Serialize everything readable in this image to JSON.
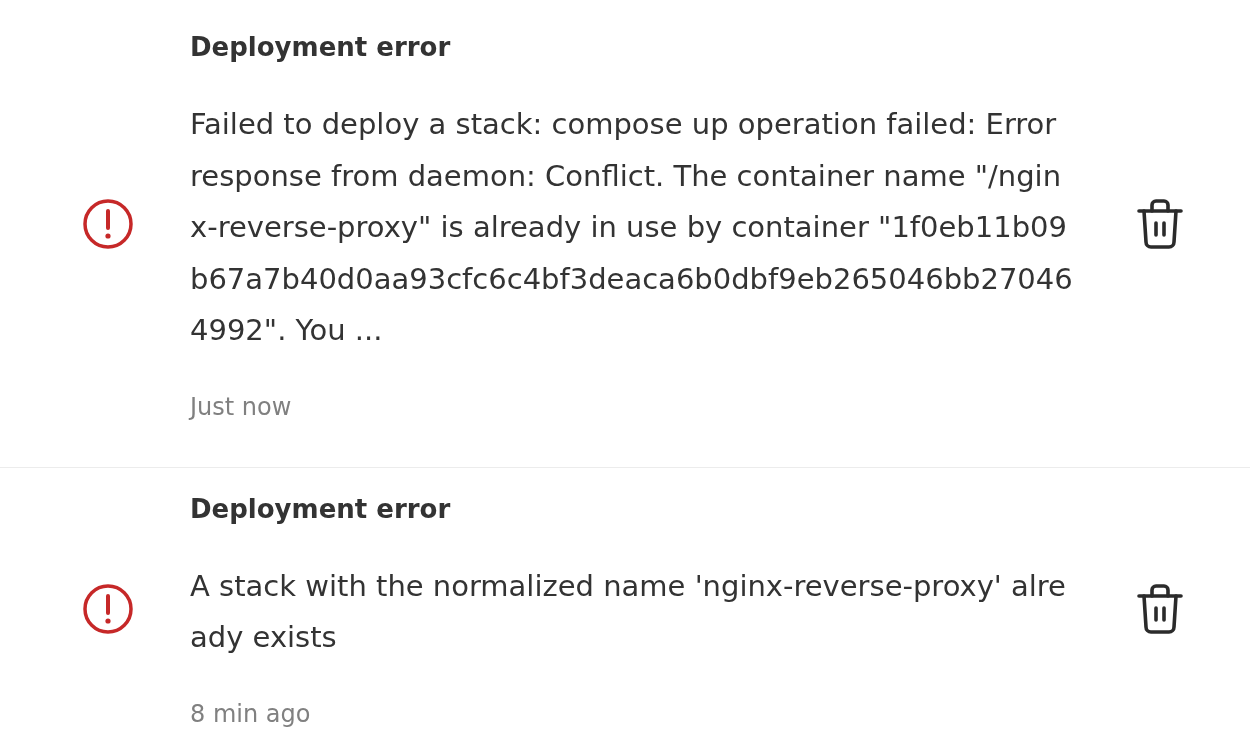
{
  "notifications": [
    {
      "kind": "error",
      "title": "Deployment error",
      "message": "Failed to deploy a stack: compose up operation failed: Error response from daemon: Conflict. The container name \"/nginx-reverse-proxy\" is already in use by container \"1f0eb11b09b67a7b40d0aa93cfc6c4bf3deaca6b0dbf9eb265046bb270464992\". You ...",
      "time": "Just now"
    },
    {
      "kind": "error",
      "title": "Deployment error",
      "message": "A stack with the normalized name 'nginx-reverse-proxy' already exists",
      "time": "8 min ago"
    }
  ]
}
